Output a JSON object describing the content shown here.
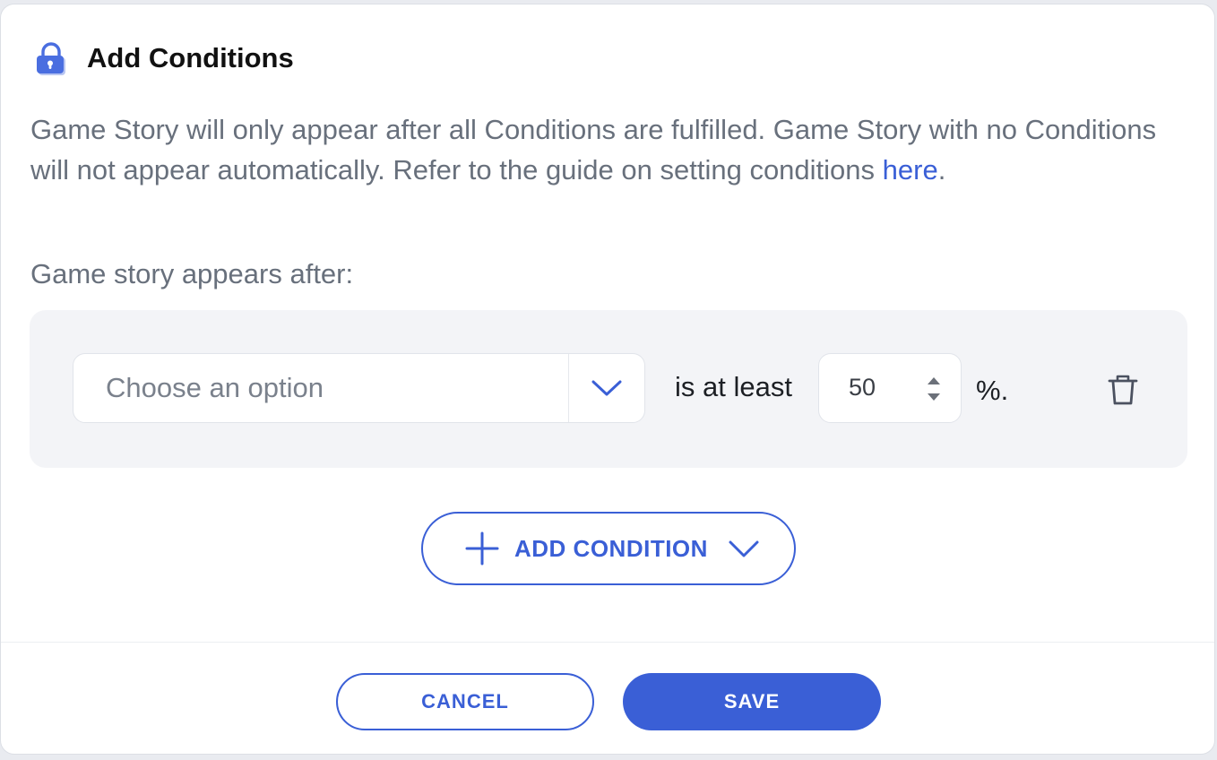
{
  "dialog": {
    "title": "Add Conditions",
    "description_text": "Game Story will only appear after all Conditions are fulfilled. Game Story with no Conditions will not appear automatically. Refer to the guide on setting conditions ",
    "description_link": "here",
    "description_end": ".",
    "sub_label": "Game story appears after:"
  },
  "condition": {
    "select_placeholder": "Choose an option",
    "operator_text": "is at least",
    "value": "50",
    "unit": "%."
  },
  "actions": {
    "add_condition_label": "ADD CONDITION",
    "cancel_label": "CANCEL",
    "save_label": "SAVE"
  },
  "colors": {
    "accent": "#3a5fd6",
    "muted_text": "#68707c",
    "condition_bg": "#f3f4f7"
  },
  "icons": {
    "header": "lock-icon",
    "select": "chevron-down-icon",
    "number": "spinner-arrows-icon",
    "delete": "trash-icon",
    "add": "plus-icon",
    "add_menu": "chevron-down-icon"
  }
}
